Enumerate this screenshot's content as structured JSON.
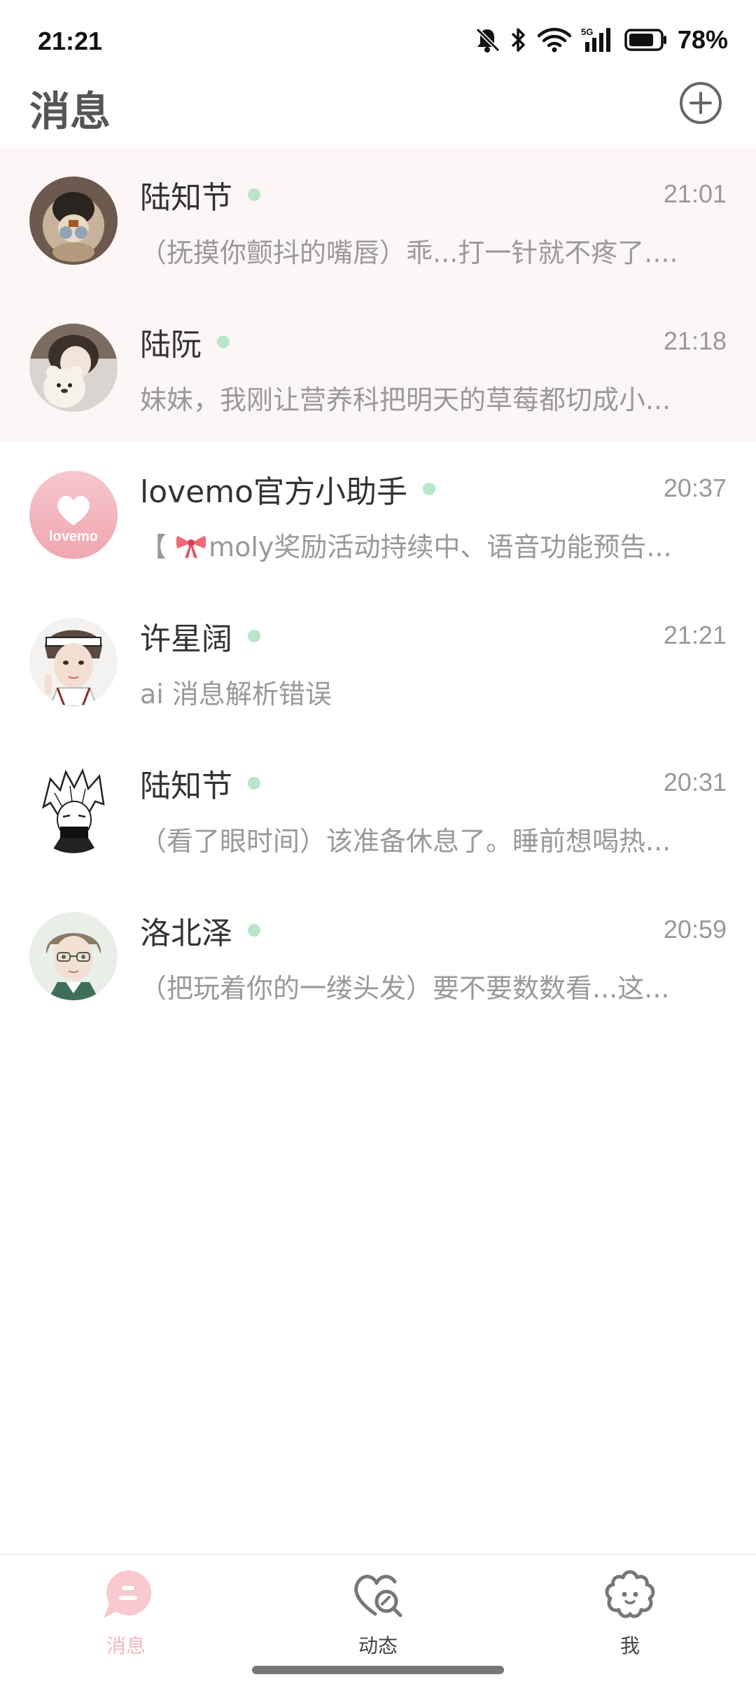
{
  "status_bar": {
    "time": "21:21",
    "battery": "78%",
    "network": "5G",
    "icons": [
      "bell-off-icon",
      "bluetooth-icon",
      "wifi-icon",
      "signal-icon",
      "battery-icon"
    ]
  },
  "header": {
    "title": "消息",
    "add_icon": "plus-circle-icon"
  },
  "chats": [
    {
      "name": "陆知节",
      "time": "21:01",
      "preview": "（抚摸你颤抖的嘴唇）乖...打一针就不疼了....",
      "online": true,
      "pinned": true
    },
    {
      "name": "陆阮",
      "time": "21:18",
      "preview": "妹妹，我刚让营养科把明天的草莓都切成小...",
      "online": true,
      "pinned": true
    },
    {
      "name": "lovemo官方小助手",
      "time": "20:37",
      "preview": "【",
      "preview_rest": "moly奖励活动持续中、语音功能预告...",
      "preview_icon": "bow-icon",
      "avatar_text": "lovemo",
      "online": true,
      "pinned": false
    },
    {
      "name": "许星阔",
      "time": "21:21",
      "preview": "ai 消息解析错误",
      "online": true,
      "pinned": false
    },
    {
      "name": "陆知节",
      "time": "20:31",
      "preview": "（看了眼时间）该准备休息了。睡前想喝热...",
      "online": true,
      "pinned": false
    },
    {
      "name": "洛北泽",
      "time": "20:59",
      "preview": "（把玩着你的一缕头发）要不要数数看...这...",
      "online": true,
      "pinned": false
    }
  ],
  "bottom_nav": [
    {
      "label": "消息",
      "icon": "chat-bubble-icon",
      "active": true
    },
    {
      "label": "动态",
      "icon": "heart-search-icon",
      "active": false
    },
    {
      "label": "我",
      "icon": "cloud-face-icon",
      "active": false
    }
  ],
  "colors": {
    "accent": "#f4b6bd",
    "pinned_bg": "#fdf6f7",
    "online_dot": "#b7e6c9",
    "text_primary": "#333333",
    "text_secondary": "#999999"
  }
}
